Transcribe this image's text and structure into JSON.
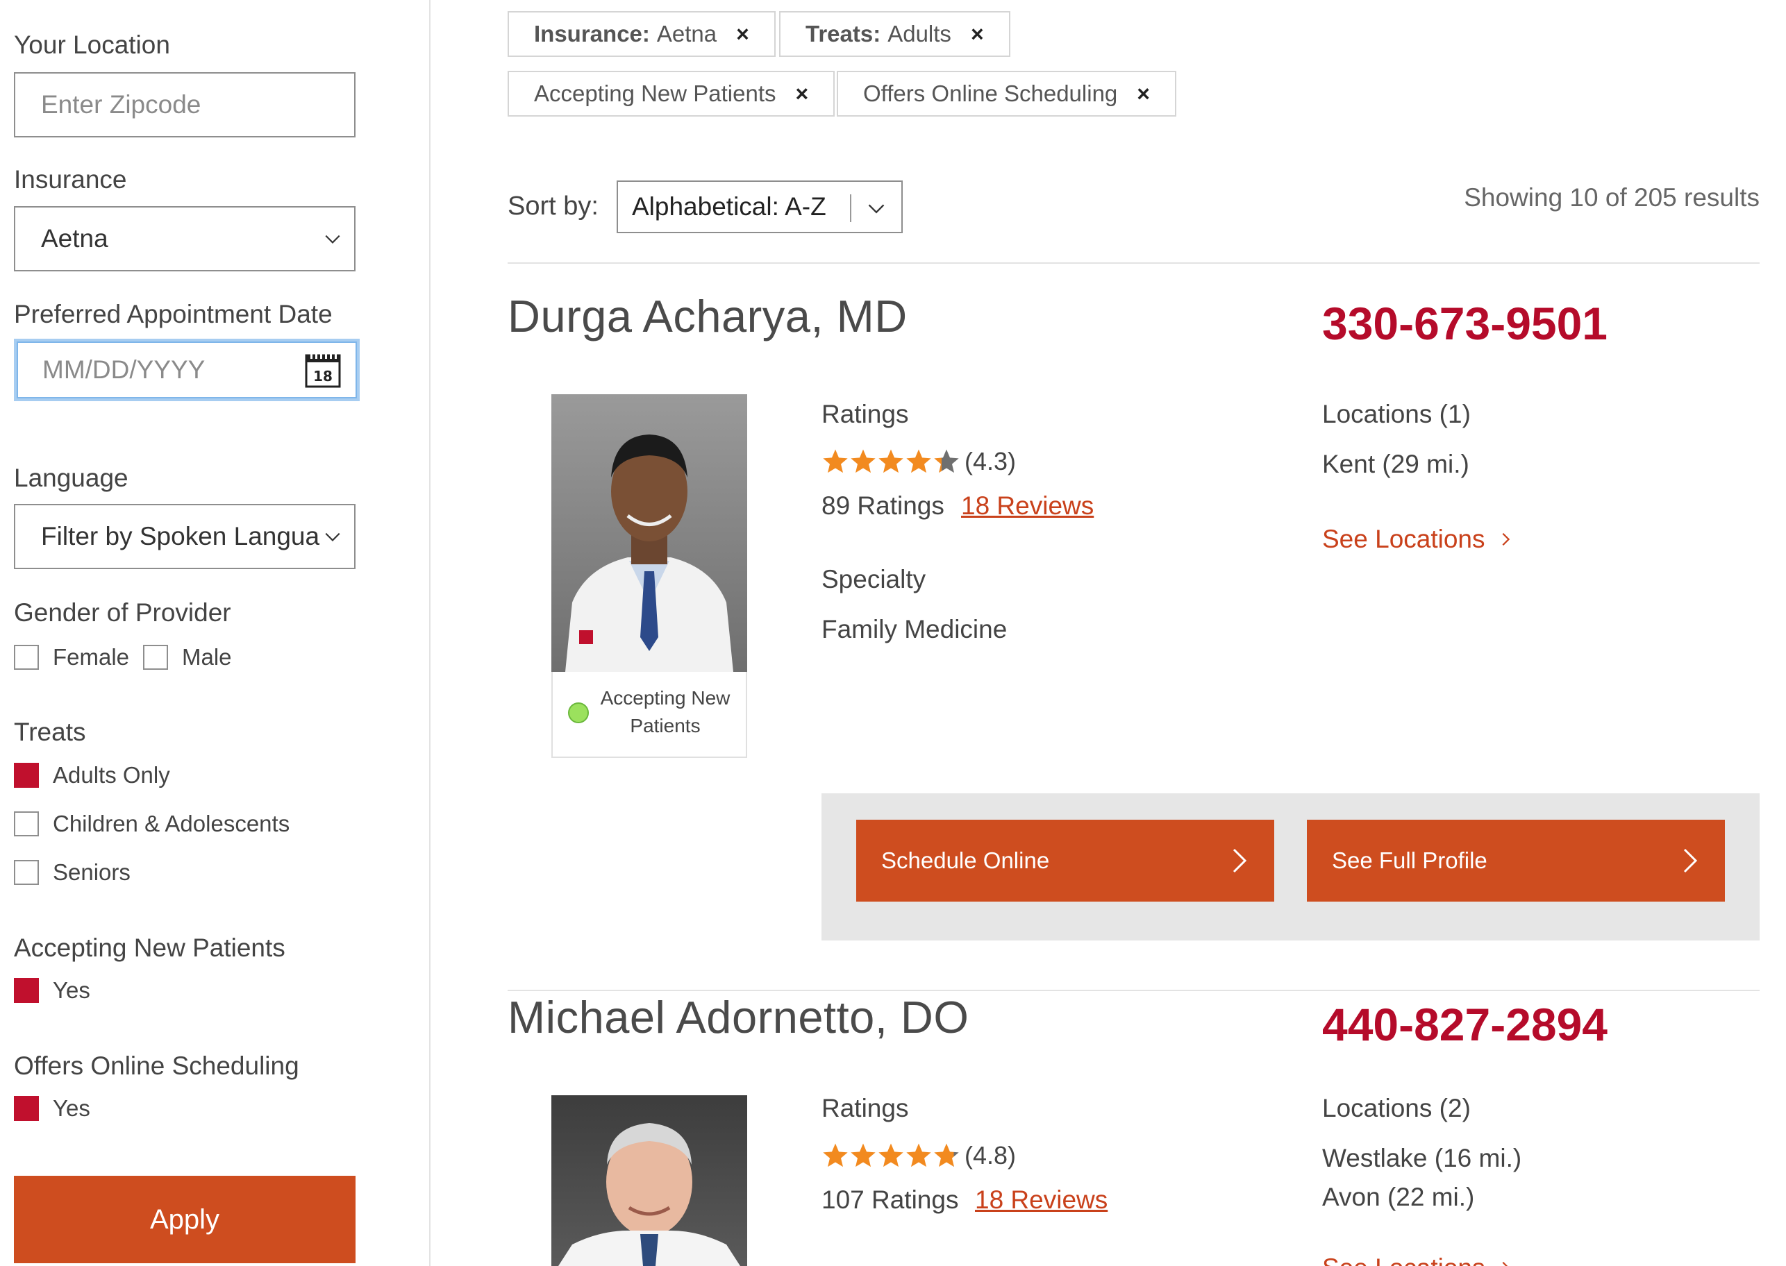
{
  "sidebar": {
    "location": {
      "label": "Your Location",
      "placeholder": "Enter Zipcode"
    },
    "insurance": {
      "label": "Insurance",
      "value": "Aetna"
    },
    "appointment": {
      "label": "Preferred Appointment Date",
      "placeholder": "MM/DD/YYYY",
      "calendar_day": "18"
    },
    "language": {
      "label": "Language",
      "value": "Filter by Spoken Langua"
    },
    "gender": {
      "label": "Gender of Provider",
      "options": [
        "Female",
        "Male"
      ],
      "checked": [
        false,
        false
      ]
    },
    "treats": {
      "label": "Treats",
      "options": [
        "Adults Only",
        "Children & Adolescents",
        "Seniors"
      ],
      "checked": [
        true,
        false,
        false
      ]
    },
    "accepting": {
      "label": "Accepting New Patients",
      "option": "Yes",
      "checked": true
    },
    "online": {
      "label": "Offers Online Scheduling",
      "option": "Yes",
      "checked": true
    },
    "apply_label": "Apply"
  },
  "filters": [
    {
      "key": "Insurance:",
      "value": "Aetna",
      "remove": "×"
    },
    {
      "key": "Treats:",
      "value": "Adults",
      "remove": "×"
    },
    {
      "key": "",
      "value": "Accepting New Patients",
      "remove": "×"
    },
    {
      "key": "",
      "value": "Offers Online Scheduling",
      "remove": "×"
    }
  ],
  "sort": {
    "label": "Sort by:",
    "value": "Alphabetical: A-Z"
  },
  "results_count": "Showing 10 of 205 results",
  "colors": {
    "brand_orange": "#ce4d1f",
    "phone_red": "#b50b2a",
    "star": "#f28a1f",
    "checked": "#c0102d"
  },
  "doctors": [
    {
      "name": "Durga Acharya, MD",
      "phone": "330-673-9501",
      "ratings_label": "Ratings",
      "rating": "(4.3)",
      "rating_value": 4.3,
      "ratings_count": "89 Ratings",
      "reviews": "18 Reviews",
      "specialty_label": "Specialty",
      "specialty": "Family Medicine",
      "locations_label": "Locations (1)",
      "locations": [
        "Kent (29 mi.)"
      ],
      "see_locations": "See Locations",
      "accepting": "Accepting New Patients",
      "schedule_label": "Schedule Online",
      "profile_label": "See Full Profile"
    },
    {
      "name": "Michael Adornetto, DO",
      "phone": "440-827-2894",
      "ratings_label": "Ratings",
      "rating": "(4.8)",
      "rating_value": 4.8,
      "ratings_count": "107 Ratings",
      "reviews": "18 Reviews",
      "locations_label": "Locations (2)",
      "locations": [
        "Westlake (16 mi.)",
        "Avon (22 mi.)"
      ],
      "see_locations": "See Locations"
    }
  ]
}
